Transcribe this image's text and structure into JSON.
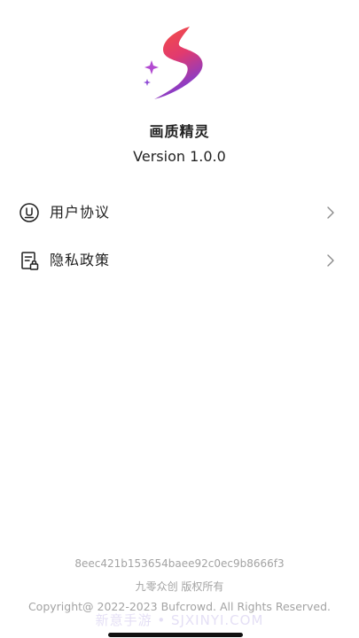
{
  "colors": {
    "background": "#ffffff",
    "text_primary": "#222222",
    "text_muted": "#a3a3a3",
    "logo_gradient_start": "#f5513f",
    "logo_gradient_mid": "#e23a6e",
    "logo_gradient_end": "#7b3cd6",
    "sparkle": "#9b4ad6"
  },
  "app": {
    "logo_icon": "lightning-s-logo-icon",
    "name": "画质精灵",
    "version": "Version 1.0.0"
  },
  "menu": {
    "items": [
      {
        "label": "用户协议",
        "icon": "user-agreement-icon",
        "chevron": "chevron-right-icon"
      },
      {
        "label": "隐私政策",
        "icon": "privacy-policy-icon",
        "chevron": "chevron-right-icon"
      }
    ]
  },
  "footer": {
    "hash": "8eec421b153654baee92c0ec9b8666f3",
    "company": "九零众创 版权所有",
    "copyright": "Copyright@ 2022-2023 Bufcrowd. All Rights Reserved."
  },
  "watermark": {
    "text": "新意手游 • SJXINYI.COM"
  }
}
